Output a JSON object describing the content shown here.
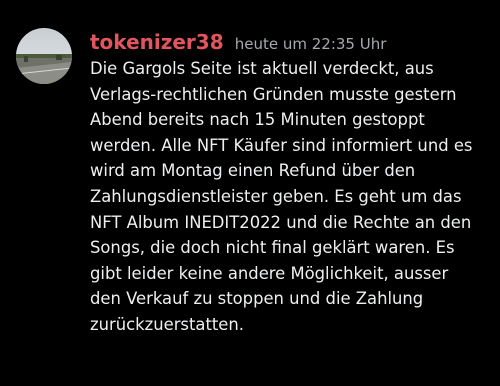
{
  "message": {
    "author": "tokenizer38",
    "timestamp": "heute um 22:35 Uhr",
    "author_color": "#e0555e",
    "lines": [
      "Die Gargols Seite ist aktuell verdeckt, aus",
      "Verlags-rechtlichen Gründen musste gestern",
      "Abend bereits nach 15 Minuten gestoppt",
      "werden. Alle NFT Käufer sind informiert und es",
      "wird am Montag einen Refund über den",
      "Zahlungsdienstleister geben. Es geht um das",
      "NFT Album INEDIT2022 und die Rechte an den",
      "Songs, die doch nicht final geklärt waren. Es",
      "gibt leider keine andere Möglichkeit, ausser",
      "den Verkauf zu stoppen und die Zahlung",
      "zurückzuerstatten."
    ]
  }
}
